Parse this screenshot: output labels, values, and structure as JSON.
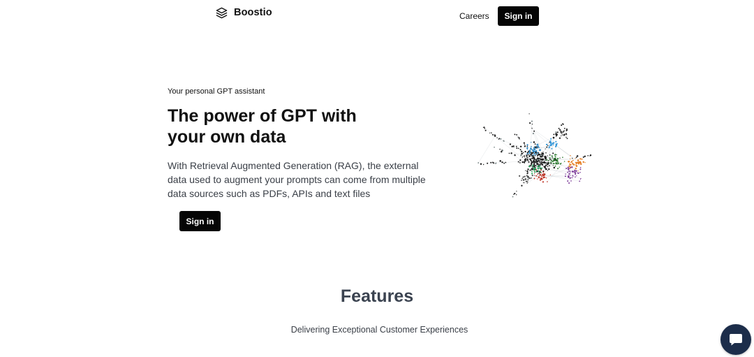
{
  "header": {
    "brand_name": "Boostio",
    "brand_icon": "layers-icon",
    "nav_careers": "Careers",
    "sign_in": "Sign in"
  },
  "hero": {
    "eyebrow": "Your personal GPT assistant",
    "title": "The power of GPT with your own data",
    "description": "With Retrieval Augmented Generation (RAG), the external data used to augment your prompts can come from multiple data sources such as PDFs, APIs and text files",
    "sign_in": "Sign in",
    "illustration": "network-graph-illustration"
  },
  "features": {
    "title": "Features",
    "subtitle": "Delivering Exceptional Customer Experiences"
  },
  "chat": {
    "icon": "chat-bubble-icon"
  },
  "colors": {
    "button_bg": "#050505",
    "button_text": "#ffffff",
    "chat_bg": "#1c2d4a",
    "heading_gray": "#3b4350"
  }
}
